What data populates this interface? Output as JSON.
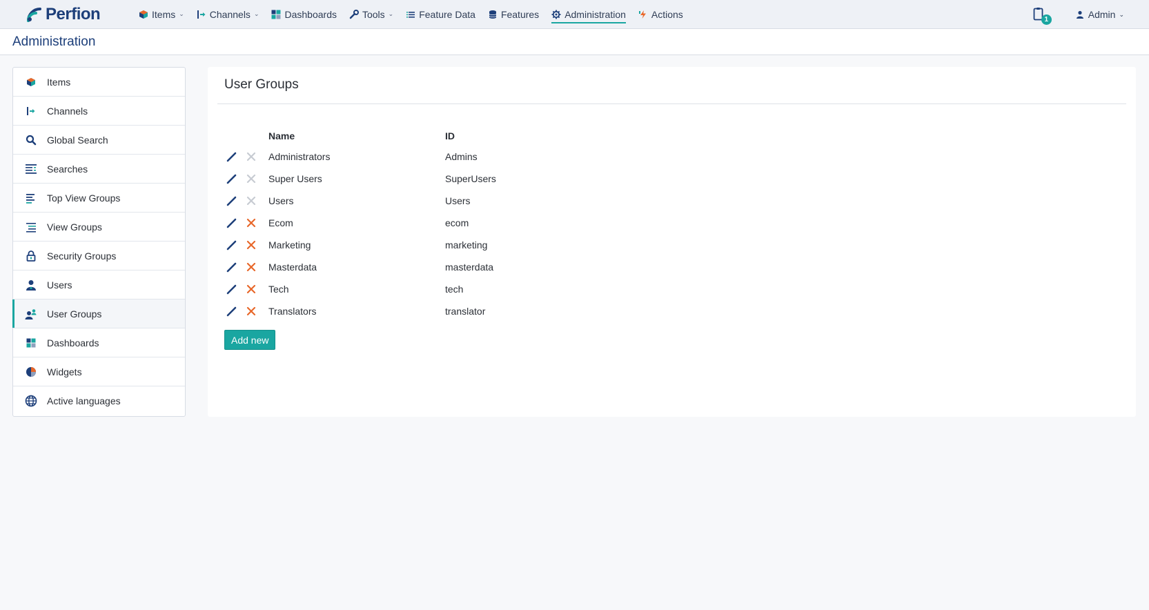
{
  "app": {
    "brand": "Perfion"
  },
  "colors": {
    "accent": "#1aa6a1",
    "brand": "#1d3f7a",
    "delete": "#e8672a",
    "delete_disabled": "#c7cbd2"
  },
  "nav": {
    "items": [
      {
        "label": "Items",
        "icon": "cube-icon",
        "dropdown": true
      },
      {
        "label": "Channels",
        "icon": "channel-icon",
        "dropdown": true
      },
      {
        "label": "Dashboards",
        "icon": "dashboard-icon",
        "dropdown": false
      },
      {
        "label": "Tools",
        "icon": "wrench-icon",
        "dropdown": true
      },
      {
        "label": "Feature Data",
        "icon": "list-icon",
        "dropdown": false
      },
      {
        "label": "Features",
        "icon": "database-icon",
        "dropdown": false
      },
      {
        "label": "Administration",
        "icon": "gear-icon",
        "dropdown": false,
        "active": true
      },
      {
        "label": "Actions",
        "icon": "lightning-icon",
        "dropdown": false
      }
    ],
    "notification_count": "1",
    "user_label": "Admin"
  },
  "page": {
    "title": "Administration"
  },
  "sidebar": {
    "items": [
      {
        "label": "Items",
        "icon": "cube-icon"
      },
      {
        "label": "Channels",
        "icon": "channel-icon"
      },
      {
        "label": "Global Search",
        "icon": "search-icon"
      },
      {
        "label": "Searches",
        "icon": "searches-icon"
      },
      {
        "label": "Top View Groups",
        "icon": "top-view-groups-icon"
      },
      {
        "label": "View Groups",
        "icon": "view-groups-icon"
      },
      {
        "label": "Security Groups",
        "icon": "lock-icon"
      },
      {
        "label": "Users",
        "icon": "user-icon"
      },
      {
        "label": "User Groups",
        "icon": "user-group-icon",
        "active": true
      },
      {
        "label": "Dashboards",
        "icon": "dashboard-icon"
      },
      {
        "label": "Widgets",
        "icon": "pie-chart-icon"
      },
      {
        "label": "Active languages",
        "icon": "globe-icon"
      }
    ]
  },
  "main": {
    "title": "User Groups",
    "columns": {
      "name": "Name",
      "id": "ID"
    },
    "rows": [
      {
        "name": "Administrators",
        "id": "Admins",
        "deletable": false
      },
      {
        "name": "Super Users",
        "id": "SuperUsers",
        "deletable": false
      },
      {
        "name": "Users",
        "id": "Users",
        "deletable": false
      },
      {
        "name": "Ecom",
        "id": "ecom",
        "deletable": true
      },
      {
        "name": "Marketing",
        "id": "marketing",
        "deletable": true
      },
      {
        "name": "Masterdata",
        "id": "masterdata",
        "deletable": true
      },
      {
        "name": "Tech",
        "id": "tech",
        "deletable": true
      },
      {
        "name": "Translators",
        "id": "translator",
        "deletable": true
      }
    ],
    "add_button": "Add new"
  }
}
